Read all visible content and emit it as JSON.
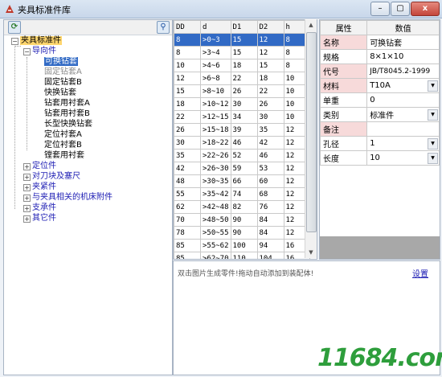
{
  "app": {
    "title": "夹具标准件库"
  },
  "window_buttons": {
    "minimize": "–",
    "restore": "▢",
    "close": "x"
  },
  "left_toolbar": {
    "refresh_glyph": "⟳",
    "search_glyph": "⚲"
  },
  "tree": {
    "root": "夹具标准件",
    "nodes": [
      {
        "label": "导向件"
      },
      {
        "label": "可换钻套"
      },
      {
        "label": "固定钻套A"
      },
      {
        "label": "固定钻套B"
      },
      {
        "label": "快换钻套"
      },
      {
        "label": "钻套用衬套A"
      },
      {
        "label": "钻套用衬套B"
      },
      {
        "label": "长型快换钻套"
      },
      {
        "label": "定位衬套A"
      },
      {
        "label": "定位衬套B"
      },
      {
        "label": "镗套用衬套"
      },
      {
        "label": "定位件"
      },
      {
        "label": "对刀块及塞尺"
      },
      {
        "label": "夹紧件"
      },
      {
        "label": "与夹具相关的机床附件"
      },
      {
        "label": "支承件"
      },
      {
        "label": "其它件"
      }
    ]
  },
  "grid": {
    "columns": [
      "DD",
      "d",
      "D1",
      "D2",
      "h"
    ],
    "rows": [
      [
        "8",
        ">0~3",
        "15",
        "12",
        "8"
      ],
      [
        "8",
        ">3~4",
        "15",
        "12",
        "8"
      ],
      [
        "10",
        ">4~6",
        "18",
        "15",
        "8"
      ],
      [
        "12",
        ">6~8",
        "22",
        "18",
        "10"
      ],
      [
        "15",
        ">8~10",
        "26",
        "22",
        "10"
      ],
      [
        "18",
        ">10~12",
        "30",
        "26",
        "10"
      ],
      [
        "22",
        ">12~15",
        "34",
        "30",
        "10"
      ],
      [
        "26",
        ">15~18",
        "39",
        "35",
        "12"
      ],
      [
        "30",
        ">18~22",
        "46",
        "42",
        "12"
      ],
      [
        "35",
        ">22~26",
        "52",
        "46",
        "12"
      ],
      [
        "42",
        ">26~30",
        "59",
        "53",
        "12"
      ],
      [
        "48",
        ">30~35",
        "66",
        "60",
        "12"
      ],
      [
        "55",
        ">35~42",
        "74",
        "68",
        "12"
      ],
      [
        "62",
        ">42~48",
        "82",
        "76",
        "12"
      ],
      [
        "70",
        ">48~50",
        "90",
        "84",
        "12"
      ],
      [
        "78",
        ">50~55",
        "90",
        "84",
        "12"
      ],
      [
        "85",
        ">55~62",
        "100",
        "94",
        "16"
      ],
      [
        "85",
        ">62~70",
        "110",
        "104",
        "16"
      ]
    ]
  },
  "props": {
    "header_attr": "属性",
    "header_val": "数值",
    "rows": [
      {
        "key": "名称",
        "value": "可换钻套"
      },
      {
        "key": "规格",
        "value": "8×1×10"
      },
      {
        "key": "代号",
        "value": "JB/T8045.2-1999"
      },
      {
        "key": "材料",
        "value": "T10A"
      },
      {
        "key": "单重",
        "value": "0"
      },
      {
        "key": "类别",
        "value": "标准件"
      },
      {
        "key": "备注",
        "value": ""
      },
      {
        "key": "孔径",
        "value": "1"
      },
      {
        "key": "长度",
        "value": "10"
      }
    ]
  },
  "bottom": {
    "hint": "双击图片生成零件!拖动自动添加到装配体!",
    "settings": "设置"
  },
  "watermark": "11684.com"
}
